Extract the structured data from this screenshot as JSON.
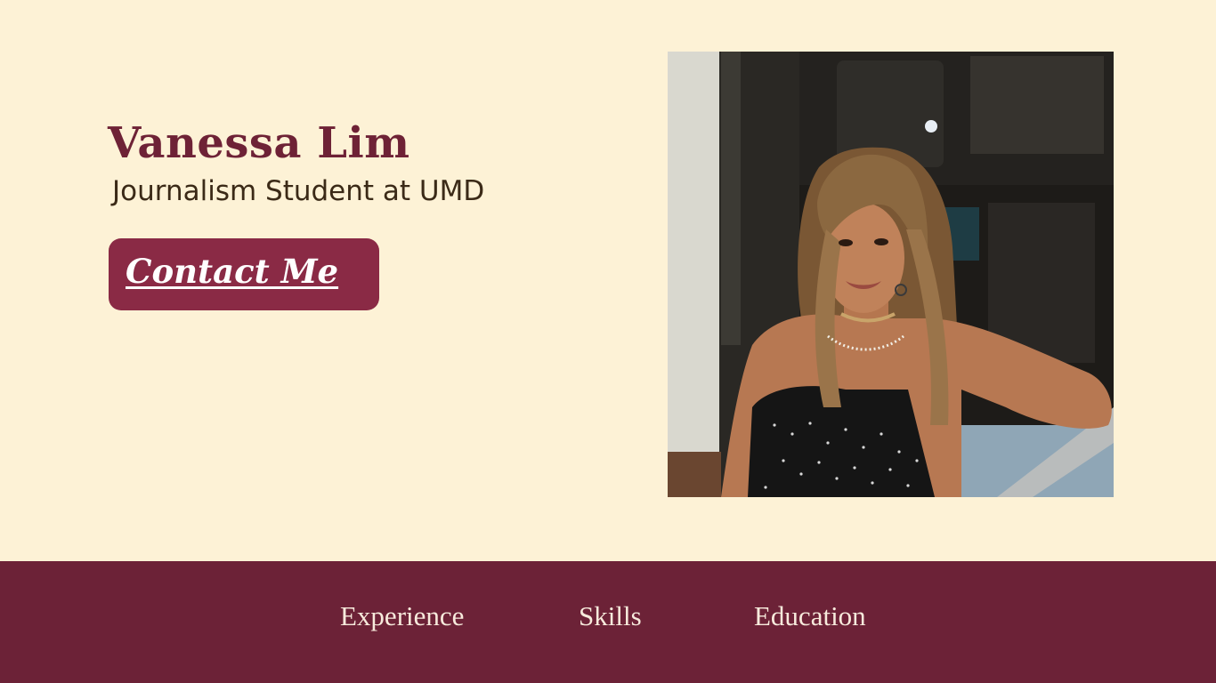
{
  "hero": {
    "name": "Vanessa Lim",
    "subtitle": "Journalism Student at UMD",
    "contact_button_label": "Contact Me"
  },
  "profile_photo": {
    "alt": "Photo of Vanessa Lim seated on a train"
  },
  "nav": {
    "items": [
      {
        "label": "Experience"
      },
      {
        "label": "Skills"
      },
      {
        "label": "Education"
      }
    ]
  },
  "colors": {
    "background": "#fdf2d6",
    "accent": "#6e2236",
    "button": "#8a2a45",
    "nav_background": "#6c2237",
    "nav_text": "#f7eadc",
    "subtitle_text": "#3b2a17"
  }
}
